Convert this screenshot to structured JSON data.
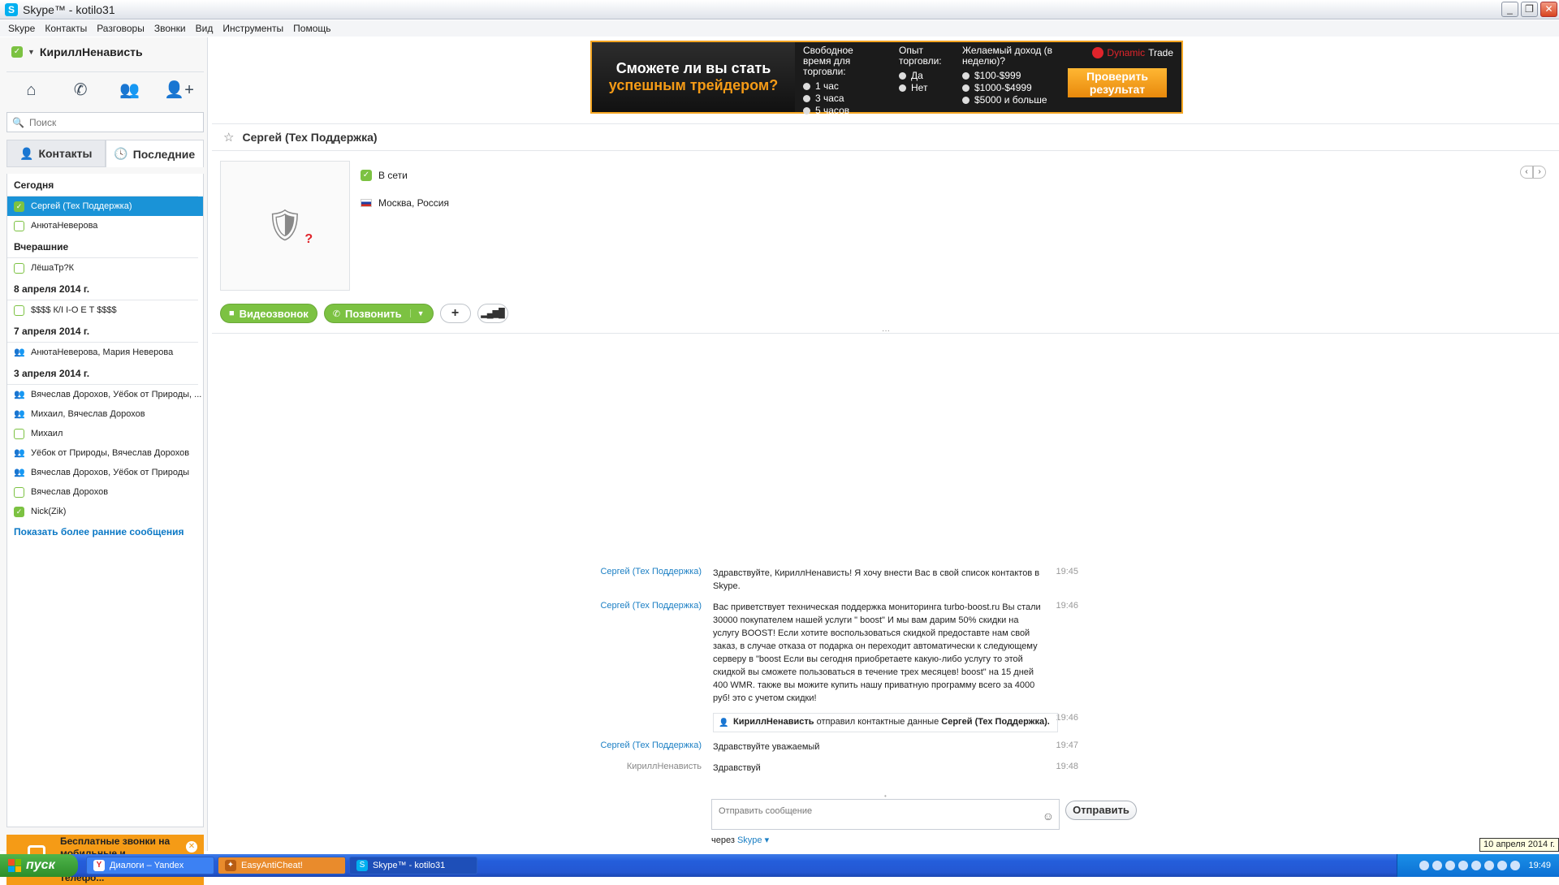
{
  "window": {
    "title": "Skype™ - kotilo31"
  },
  "menu": [
    "Skype",
    "Контакты",
    "Разговоры",
    "Звонки",
    "Вид",
    "Инструменты",
    "Помощь"
  ],
  "profile": {
    "name": "КириллНенависть"
  },
  "search": {
    "placeholder": "Поиск"
  },
  "tabs": {
    "contacts": "Контакты",
    "recent": "Последние"
  },
  "contact_groups": [
    {
      "label": "Сегодня",
      "items": [
        {
          "name": "Сергей (Тех Поддержка)",
          "status": "online",
          "selected": true
        },
        {
          "name": "АнютаНеверова",
          "status": "offline"
        }
      ]
    },
    {
      "label": "Вчерашние",
      "items": [
        {
          "name": "ЛёшаТр?К",
          "status": "offline"
        }
      ]
    },
    {
      "label": "8 апреля 2014 г.",
      "items": [
        {
          "name": "$$$$ К/I I-O E T $$$$",
          "status": "offline"
        }
      ]
    },
    {
      "label": "7 апреля 2014 г.",
      "items": [
        {
          "name": "АнютаНеверова, Мария Неверова",
          "status": "group"
        }
      ]
    },
    {
      "label": "3 апреля 2014 г.",
      "items": [
        {
          "name": "Вячеслав Дорохов, Уёбок от Природы, ...",
          "status": "group"
        },
        {
          "name": "Михаил, Вячеслав Дорохов",
          "status": "group"
        },
        {
          "name": "Михаил",
          "status": "offline"
        },
        {
          "name": "Уёбок от Природы, Вячеслав Дорохов",
          "status": "group"
        },
        {
          "name": "Вячеслав Дорохов, Уёбок от Природы",
          "status": "group"
        },
        {
          "name": "Вячеслав Дорохов",
          "status": "offline"
        },
        {
          "name": "Nick(Zik)",
          "status": "online"
        }
      ]
    }
  ],
  "show_more": "Показать более ранние сообщения",
  "promo": {
    "text": "Бесплатные звонки на мобильные и стационарные телефо..."
  },
  "ad": {
    "headline1": "Сможете ли вы стать",
    "headline2": "успешным трейдером?",
    "col1_title": "Свободное время для торговли:",
    "col1_options": [
      "1 час",
      "3 часа",
      "5 часов"
    ],
    "col2_title": "Опыт торговли:",
    "col2_options": [
      "Да",
      "Нет"
    ],
    "col3_title": "Желаемый доход (в неделю)?",
    "col3_options": [
      "$100-$999",
      "$1000-$4999",
      "$5000 и больше"
    ],
    "brand_dyn": "Dynamic",
    "brand_trade": "Trade",
    "button": "Проверить результат",
    "brand_color": "#f59b16"
  },
  "conversation": {
    "contact_name": "Сергей (Тех Поддержка)",
    "status": "В сети",
    "location": "Москва, Россия",
    "video_call": "Видеозвонок",
    "call": "Позвонить"
  },
  "messages": [
    {
      "from": "Сергей (Тех Поддержка)",
      "text": "Здравствуйте, КириллНенависть! Я хочу внести Вас в свой список контактов в Skype.",
      "time": "19:45"
    },
    {
      "from": "Сергей (Тех Поддержка)",
      "text": "Вас приветствует техническая поддержка мониторинга turbo-boost.ru Вы стали 30000 покупателем нашей услуги \" boost\" И мы вам дарим 50% скидки на услугу BOOST! Если хотите воспользоваться скидкой предоставте нам свой заказ, в случае отказа от подарка он переходит автоматически к следующему серверу в \"boost Если вы сегодня приобретаете какую-либо услугу то этой скидкой вы сможете пользоваться в течение трех месяцев! boost\" на 15 дней 400 WMR. также вы можите купить нашу приватную программу всего за 4000 руб! это с учетом скидки!",
      "time": "19:46"
    },
    {
      "card": true,
      "sender": "КириллНенависть",
      "action": "отправил контактные данные",
      "contact": "Сергей (Тех Поддержка).",
      "time": "19:46"
    },
    {
      "from": "Сергей (Тех Поддержка)",
      "text": "Здравствуйте уважаемый",
      "time": "19:47"
    },
    {
      "from": "КириллНенависть",
      "me": true,
      "text": "Здравствуй",
      "time": "19:48"
    }
  ],
  "compose": {
    "placeholder": "Отправить сообщение",
    "send": "Отправить",
    "via_label": "через",
    "via_value": "Skype"
  },
  "taskbar": {
    "start": "пуск",
    "tasks": [
      "Диалоги – Yandex",
      "EasyAntiCheat!",
      "Skype™ - kotilo31"
    ],
    "clock": "19:49",
    "tooltip": "10 апреля 2014 г."
  }
}
